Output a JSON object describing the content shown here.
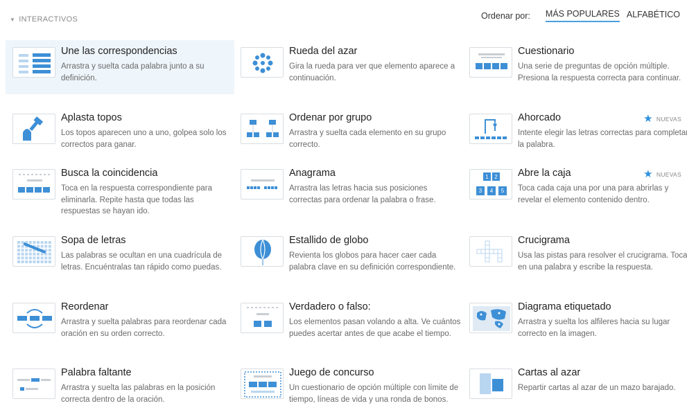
{
  "section": {
    "label": "INTERACTIVOS",
    "caret_icon": "caret-down-icon"
  },
  "sort": {
    "label": "Ordenar por:",
    "options": [
      "MÁS POPULARES",
      "ALFABÉTICO"
    ],
    "selected": "MÁS POPULARES"
  },
  "colors": {
    "accent": "#2b90e0",
    "highlight": "#eef5fb"
  },
  "templates": [
    {
      "title": "Une las correspondencias",
      "desc": "Arrastra y suelta cada palabra junto a su definición.",
      "icon": "match-up-icon"
    },
    {
      "title": "Rueda del azar",
      "desc": "Gira la rueda para ver que elemento aparece a continuación.",
      "icon": "wheel-icon"
    },
    {
      "title": "Cuestionario",
      "desc": "Una serie de preguntas de opción múltiple. Presiona la respuesta correcta para continuar.",
      "icon": "quiz-icon"
    },
    {
      "title": "Aplasta topos",
      "desc": "Los topos aparecen uno a uno, golpea solo los correctos para ganar.",
      "icon": "whack-mole-icon"
    },
    {
      "title": "Ordenar por grupo",
      "desc": "Arrastra y suelta cada elemento en su grupo correcto.",
      "icon": "group-sort-icon"
    },
    {
      "title": "Ahorcado",
      "desc": "Intente elegir las letras correctas para completar la palabra.",
      "icon": "hangman-icon",
      "badge": "NUEVAS"
    },
    {
      "title": "Busca la coincidencia",
      "desc": "Toca en la respuesta correspondiente para eliminarla. Repite hasta que todas las respuestas se hayan ido.",
      "icon": "find-match-icon"
    },
    {
      "title": "Anagrama",
      "desc": "Arrastra las letras hacia sus posiciones correctas para ordenar la palabra o frase.",
      "icon": "anagram-icon"
    },
    {
      "title": "Abre la caja",
      "desc": "Toca cada caja una por una para abrirlas y revelar el elemento contenido dentro.",
      "icon": "open-box-icon",
      "badge": "NUEVAS",
      "box_labels": [
        "1",
        "2",
        "3",
        "4",
        "5"
      ]
    },
    {
      "title": "Sopa de letras",
      "desc": "Las palabras se ocultan en una cuadrícula de letras. Encuéntralas tan rápido como puedas.",
      "icon": "wordsearch-icon"
    },
    {
      "title": "Estallido de globo",
      "desc": "Revienta los globos para hacer caer cada palabra clave en su definición correspondiente.",
      "icon": "balloon-icon"
    },
    {
      "title": "Crucigrama",
      "desc": "Usa las pistas para resolver el crucigrama. Toca en una palabra y escribe la respuesta.",
      "icon": "crossword-icon"
    },
    {
      "title": "Reordenar",
      "desc": "Arrastra y suelta palabras para reordenar cada oración en su orden correcto.",
      "icon": "unjumble-icon"
    },
    {
      "title": "Verdadero o falso:",
      "desc": "Los elementos pasan volando a alta. Ve cuántos puedes acertar antes de que acabe el tiempo.",
      "icon": "true-false-icon"
    },
    {
      "title": "Diagrama etiquetado",
      "desc": "Arrastra y suelta los alfileres hacia su lugar correcto en la imagen.",
      "icon": "labelled-diagram-icon"
    },
    {
      "title": "Palabra faltante",
      "desc": "Arrastra y suelta las palabras en la posición correcta dentro de la oración.",
      "icon": "missing-word-icon"
    },
    {
      "title": "Juego de concurso",
      "desc": "Un cuestionario de opción múltiple con límite de tiempo, líneas de vida y una ronda de bonos.",
      "icon": "gameshow-quiz-icon"
    },
    {
      "title": "Cartas al azar",
      "desc": "Repartir cartas al azar de un mazo barajado.",
      "icon": "random-cards-icon"
    }
  ]
}
